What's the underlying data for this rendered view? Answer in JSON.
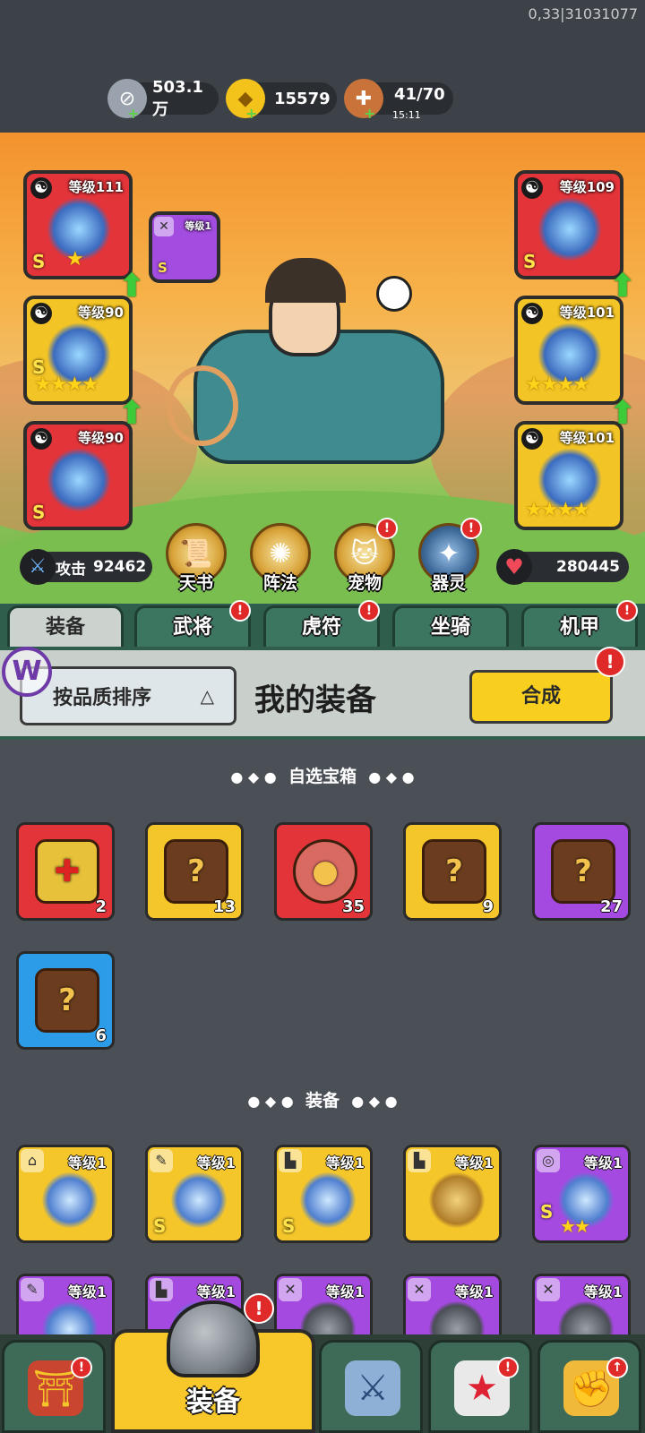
{
  "debug_text": "0,33|31031077",
  "resources": {
    "silver": {
      "value": "503.1万",
      "icon": "silver-coin-icon"
    },
    "gold": {
      "value": "15579",
      "icon": "gold-ingot-icon"
    },
    "stamina": {
      "value": "41/70",
      "timer": "15:11",
      "icon": "meat-leg-icon"
    }
  },
  "left_slots": [
    {
      "level": "等级111",
      "grade": "S",
      "stars": "★",
      "color": "red"
    },
    {
      "level": "等级90",
      "grade": "S",
      "stars": "★★★★",
      "color": "gold"
    },
    {
      "level": "等级90",
      "grade": "S",
      "stars": "",
      "color": "red"
    }
  ],
  "right_slots": [
    {
      "level": "等级109",
      "grade": "S",
      "stars": "",
      "color": "red"
    },
    {
      "level": "等级101",
      "grade": "",
      "stars": "★★★★",
      "color": "gold"
    },
    {
      "level": "等级101",
      "grade": "",
      "stars": "★★★★",
      "color": "gold"
    }
  ],
  "weapon_slot": {
    "level": "等级1",
    "grade": "S"
  },
  "attack": {
    "label": "攻击",
    "value": "92462"
  },
  "hp": {
    "value": "280445"
  },
  "features": [
    {
      "label": "天书",
      "icon": "scroll-icon",
      "alert": false
    },
    {
      "label": "阵法",
      "icon": "formation-icon",
      "alert": false
    },
    {
      "label": "宠物",
      "icon": "cat-pet-icon",
      "alert": true
    },
    {
      "label": "器灵",
      "icon": "spirit-icon",
      "alert": true
    }
  ],
  "tabs": [
    {
      "label": "装备",
      "active": true,
      "alert": false
    },
    {
      "label": "武将",
      "active": false,
      "alert": true
    },
    {
      "label": "虎符",
      "active": false,
      "alert": true
    },
    {
      "label": "坐骑",
      "active": false,
      "alert": false
    },
    {
      "label": "机甲",
      "active": false,
      "alert": true
    }
  ],
  "bag": {
    "sort_label": "按品质排序",
    "title": "我的装备",
    "merge_label": "合成",
    "logo_letter": "W"
  },
  "sections": {
    "chests_title": "自选宝箱",
    "equip_title": "装备",
    "dots_left": "● ◆ ●",
    "dots_right": "● ◆ ●"
  },
  "chests": [
    {
      "count": "2",
      "color": "red"
    },
    {
      "count": "13",
      "color": "gold"
    },
    {
      "count": "35",
      "color": "red"
    },
    {
      "count": "9",
      "color": "gold"
    },
    {
      "count": "27",
      "color": "purple"
    },
    {
      "count": "6",
      "color": "blue"
    }
  ],
  "equipment_row1": [
    {
      "level": "等级1",
      "grade": "",
      "stars": "",
      "color": "gold",
      "type_icon": "helmet-icon"
    },
    {
      "level": "等级1",
      "grade": "S",
      "stars": "",
      "color": "gold",
      "type_icon": "armor-icon"
    },
    {
      "level": "等级1",
      "grade": "S",
      "stars": "",
      "color": "gold",
      "type_icon": "boots-icon"
    },
    {
      "level": "等级1",
      "grade": "",
      "stars": "",
      "color": "gold",
      "type_icon": "boots-icon"
    },
    {
      "level": "等级1",
      "grade": "S",
      "stars": "★★",
      "color": "purple",
      "type_icon": "medal-icon"
    }
  ],
  "equipment_row2": [
    {
      "level": "等级1",
      "color": "purple",
      "type_icon": "armor-icon"
    },
    {
      "level": "等级1",
      "color": "purple",
      "type_icon": "boots-icon"
    },
    {
      "level": "等级1",
      "color": "purple",
      "type_icon": "sword-icon"
    },
    {
      "level": "等级1",
      "color": "purple",
      "type_icon": "sword-icon"
    },
    {
      "level": "等级1",
      "color": "purple",
      "type_icon": "sword-icon"
    }
  ],
  "bottom_nav": {
    "active_label": "装备",
    "items": [
      {
        "icon": "shop-gate-icon",
        "alert": true
      },
      {
        "icon": "crossed-swords-icon",
        "alert": false
      },
      {
        "icon": "rooster-icon",
        "alert": true
      },
      {
        "icon": "fist-upgrade-icon",
        "alert": true
      }
    ]
  },
  "alert_glyph": "!",
  "colors": {
    "red": "#e3343a",
    "gold": "#f5c62a",
    "purple": "#a54ae0",
    "blue": "#2c9be8",
    "tab_green": "#3d7660"
  }
}
